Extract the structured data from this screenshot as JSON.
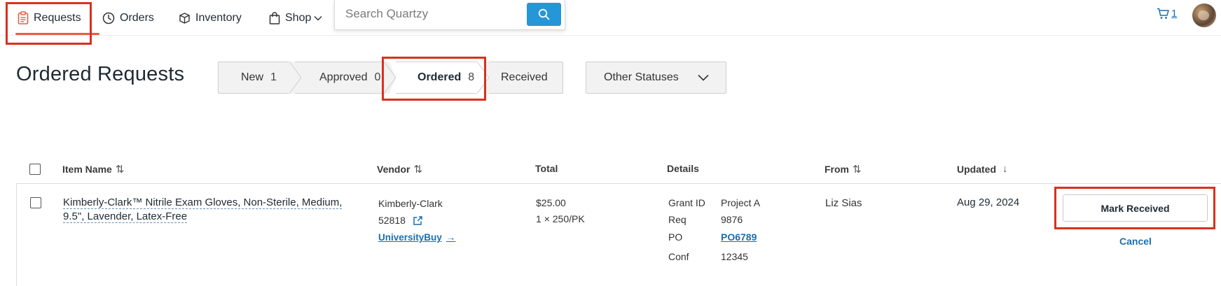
{
  "nav": {
    "requests": "Requests",
    "orders": "Orders",
    "inventory": "Inventory",
    "shop": "Shop"
  },
  "search": {
    "placeholder": "Search Quartzy"
  },
  "cart": {
    "count": "1"
  },
  "page": {
    "title": "Ordered Requests"
  },
  "status_tabs": [
    {
      "label": "New",
      "count": "1"
    },
    {
      "label": "Approved",
      "count": "0"
    },
    {
      "label": "Ordered",
      "count": "8"
    },
    {
      "label": "Received",
      "count": ""
    }
  ],
  "other_statuses": {
    "label": "Other Statuses"
  },
  "table": {
    "columns": {
      "item_name": "Item Name",
      "vendor": "Vendor",
      "total": "Total",
      "details": "Details",
      "from": "From",
      "updated": "Updated"
    },
    "rows": [
      {
        "item_name": "Kimberly-Clark™ Nitrile Exam Gloves, Non-Sterile, Medium, 9.5\", Lavender, Latex-Free",
        "vendor_name": "Kimberly-Clark",
        "vendor_code": "52818",
        "vendor_source": "UniversityBuy",
        "total": "$25.00",
        "pack": "1 × 250/PK",
        "details": {
          "grant_label": "Grant ID",
          "grant_value": "Project A",
          "req_label": "Req",
          "req_value": "9876",
          "po_label": "PO",
          "po_value": "PO6789",
          "conf_label": "Conf",
          "conf_value": "12345"
        },
        "from": "Liz Sias",
        "updated": "Aug 29, 2024",
        "action_primary": "Mark Received",
        "action_secondary": "Cancel"
      }
    ]
  },
  "colors": {
    "accent_orange": "#e6603f",
    "link_blue": "#1a6fb0",
    "search_button": "#2596d8",
    "highlight_red": "#d9301f"
  }
}
